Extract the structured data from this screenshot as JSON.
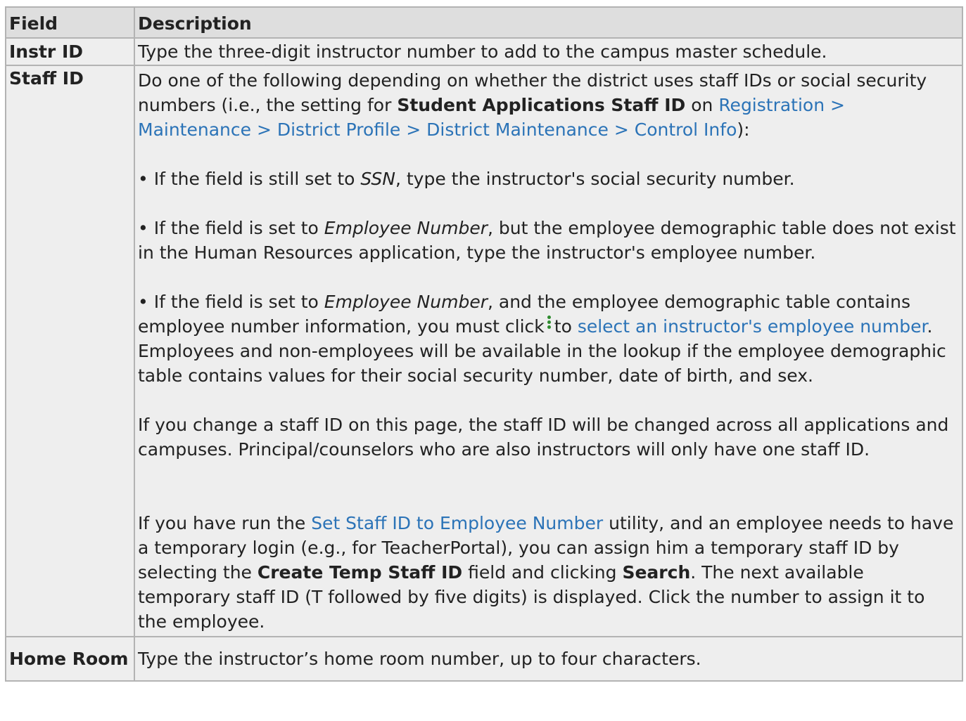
{
  "headers": {
    "field": "Field",
    "description": "Description"
  },
  "rows": {
    "instr": {
      "field": "Instr ID",
      "description": "Type the three-digit instructor number to add to the campus master schedule."
    },
    "staff": {
      "field": "Staff ID",
      "intro_a": "Do one of the following depending on whether the district uses staff IDs or social security numbers (i.e., the setting for ",
      "intro_bold": "Student Applications Staff ID",
      "intro_b": " on ",
      "intro_link": "Registration > Maintenance > District Profile > District Maintenance > Control Info",
      "intro_c": "):",
      "b1_a": "• If the field is still set to ",
      "b1_i": "SSN",
      "b1_b": ", type the instructor's social security number.",
      "b2_a": "• If the field is set to ",
      "b2_i": "Employee Number",
      "b2_b": ", but the employee demographic table does not exist in the Human Resources application, type the instructor's employee number.",
      "b3_a": "• If the field is set to ",
      "b3_i": "Employee Number",
      "b3_b": ", and the employee demographic table contains employee number information, you must click",
      "b3_icon": "kebab-menu-icon",
      "b3_c": "to ",
      "b3_link": "select an instructor's employee number",
      "b3_d": ". Employees and non-employees will be available in the lookup if the employee demographic table contains values for their social security number, date of birth, and sex.",
      "p4": "If you change a staff ID on this page, the staff ID will be changed across all applications and campuses. Principal/counselors who are also instructors will only have one staff ID.",
      "p5_a": "If you have run the ",
      "p5_link": "Set Staff ID to Employee Number",
      "p5_b": " utility, and an employee needs to have a temporary login (e.g., for TeacherPortal), you can assign him a temporary staff ID by selecting the ",
      "p5_bold1": "Create Temp Staff ID",
      "p5_c": " field and clicking ",
      "p5_bold2": "Search",
      "p5_d": ". The next available temporary staff ID (T followed by five digits) is displayed. Click the number to assign it to the employee."
    },
    "home": {
      "field": "Home Room",
      "description": "Type the instructor’s home room number, up to four characters."
    }
  },
  "colors": {
    "link": "#2b73b7",
    "header_bg": "#dedede",
    "cell_bg": "#eeeeee",
    "border": "#b3b3b3",
    "icon": "#2e8b2e"
  }
}
